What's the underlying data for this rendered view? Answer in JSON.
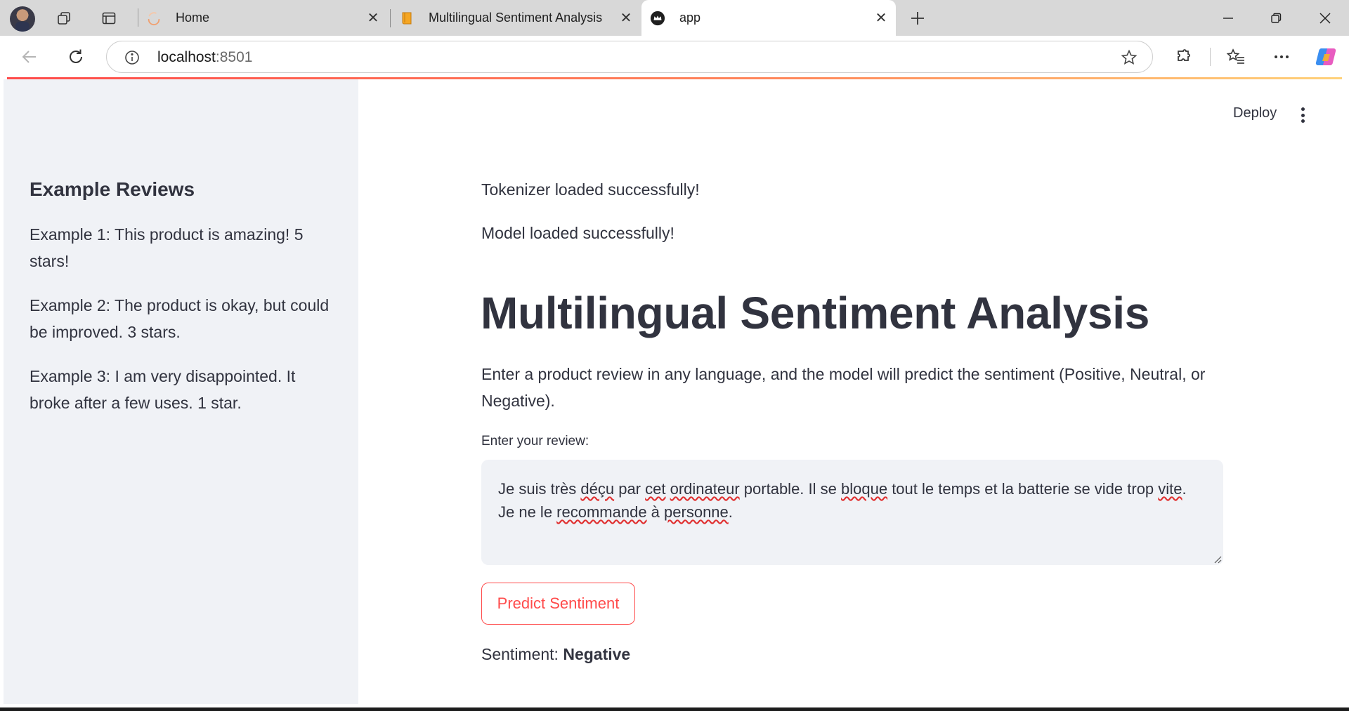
{
  "browser": {
    "tabs": [
      {
        "title": "Home",
        "favicon": "spinner-icon"
      },
      {
        "title": "Multilingual Sentiment Analysis",
        "favicon": "book-icon"
      },
      {
        "title": "app",
        "favicon": "streamlit-crown-icon",
        "active": true
      }
    ],
    "url_host": "localhost",
    "url_port": ":8501",
    "accent_color": "#ff4b4b"
  },
  "sidebar": {
    "heading": "Example Reviews",
    "examples": [
      "Example 1: This product is amazing! 5 stars!",
      "Example 2: The product is okay, but could be improved. 3 stars.",
      "Example 3: I am very disappointed. It broke after a few uses. 1 star."
    ]
  },
  "header": {
    "deploy_label": "Deploy"
  },
  "main": {
    "messages": [
      "Tokenizer loaded successfully!",
      "Model loaded successfully!"
    ],
    "title": "Multilingual Sentiment Analysis",
    "description": "Enter a product review in any language, and the model will predict the sentiment (Positive, Neutral, or Negative).",
    "review_label": "Enter your review:",
    "review_text_parts": [
      "Je suis très ",
      "déçu",
      " par ",
      "cet",
      " ",
      "ordinateur",
      " portable. Il se ",
      "bloque",
      " tout le temps et la batterie se vide trop ",
      "vite",
      ". Je ne le ",
      "recommande",
      " à ",
      "personne",
      "."
    ],
    "predict_button": "Predict Sentiment",
    "result_label": "Sentiment: ",
    "result_value": "Negative"
  }
}
